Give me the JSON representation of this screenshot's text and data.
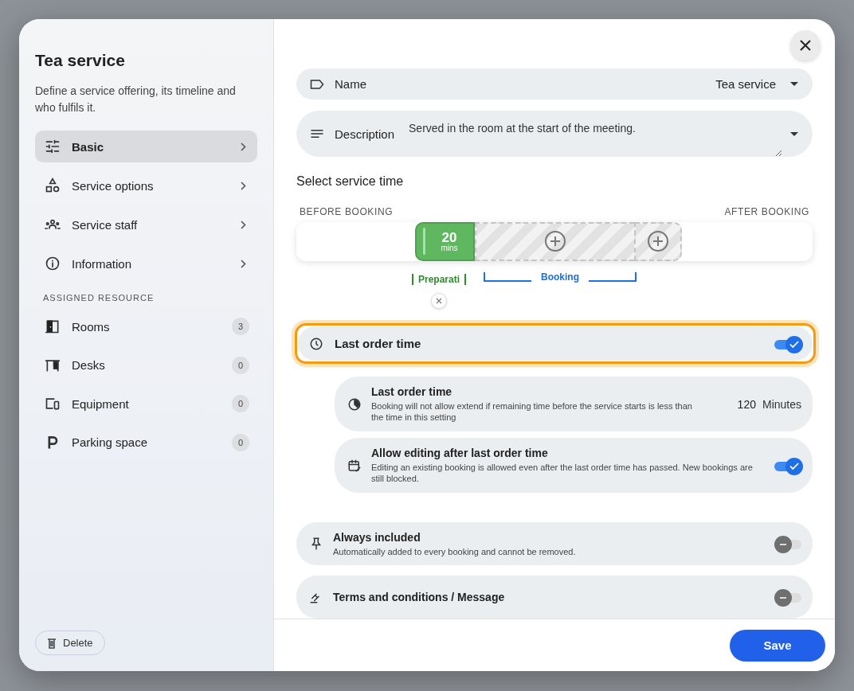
{
  "dialog": {
    "title": "Tea service",
    "description": "Define a service offering, its timeline and who fulfils it."
  },
  "sidebar": {
    "items": [
      {
        "label": "Basic",
        "selected": true
      },
      {
        "label": "Service options",
        "selected": false
      },
      {
        "label": "Service staff",
        "selected": false
      },
      {
        "label": "Information",
        "selected": false
      }
    ],
    "section_title": "ASSIGNED RESOURCE",
    "resources": [
      {
        "label": "Rooms",
        "count": "3"
      },
      {
        "label": "Desks",
        "count": "0"
      },
      {
        "label": "Equipment",
        "count": "0"
      },
      {
        "label": "Parking space",
        "count": "0"
      }
    ],
    "delete_button": "Delete"
  },
  "form": {
    "name": {
      "label": "Name",
      "value": "Tea service"
    },
    "description": {
      "label": "Description",
      "value": "Served in the room at the start of the meeting."
    },
    "service_time": {
      "title": "Select service time",
      "before_label": "BEFORE BOOKING",
      "after_label": "AFTER BOOKING",
      "preparation": {
        "value": "20",
        "unit": "mins",
        "label": "Preparati"
      },
      "booking_label": "Booking"
    },
    "last_order": {
      "label": "Last order time",
      "on": true,
      "highlighted": true,
      "settings": [
        {
          "kind": "value",
          "title": "Last order time",
          "subtitle": "Booking will not allow extend if remaining time before the service starts is less than the time in this setting",
          "value": "120",
          "unit": "Minutes"
        },
        {
          "kind": "toggle",
          "title": "Allow editing after last order time",
          "subtitle": "Editing an existing booking is allowed even after the last order time has passed. New bookings are still blocked.",
          "on": true
        }
      ]
    },
    "options": [
      {
        "title": "Always included",
        "subtitle": "Automatically added to every booking and cannot be removed.",
        "on": false
      },
      {
        "title": "Terms and conditions / Message",
        "on": false
      }
    ]
  },
  "footer": {
    "save_button": "Save"
  }
}
